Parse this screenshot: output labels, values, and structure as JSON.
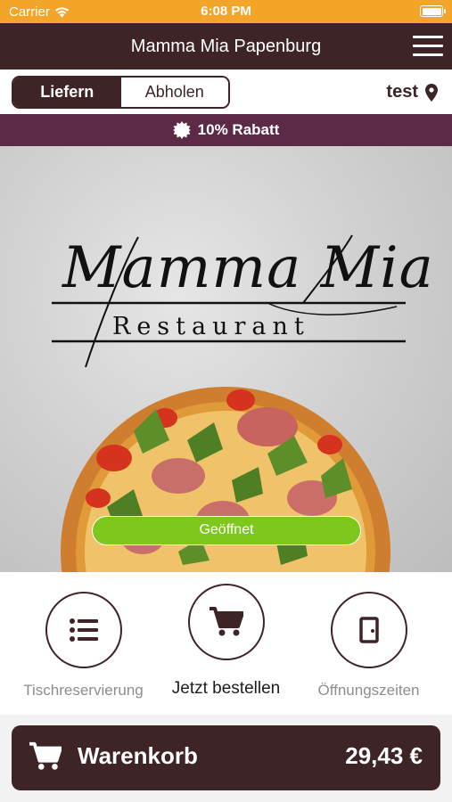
{
  "status_bar": {
    "carrier": "Carrier",
    "time": "6:08 PM"
  },
  "nav": {
    "title": "Mamma Mia Papenburg",
    "menu_icon": "hamburger-menu-icon"
  },
  "delivery": {
    "options": [
      {
        "label": "Liefern",
        "active": true
      },
      {
        "label": "Abholen",
        "active": false
      }
    ],
    "location_label": "test",
    "location_icon": "map-pin-icon"
  },
  "discount": {
    "label": "10% Rabatt",
    "icon": "badge-icon"
  },
  "hero": {
    "logo_script": "Mamma Mia",
    "logo_word": "Restaurant",
    "status_label": "Geöffnet"
  },
  "actions": [
    {
      "label": "Tischreservierung",
      "icon": "list-icon"
    },
    {
      "label": "Jetzt bestellen",
      "icon": "cart-icon"
    },
    {
      "label": "Öffnungszeiten",
      "icon": "door-icon"
    }
  ],
  "cart": {
    "label": "Warenkorb",
    "total": "29,43 €",
    "icon": "cart-icon"
  },
  "colors": {
    "status_bar": "#f3a52a",
    "primary": "#3e2426",
    "discount_banner": "#5c2a45",
    "open_status": "#7ec81e"
  }
}
